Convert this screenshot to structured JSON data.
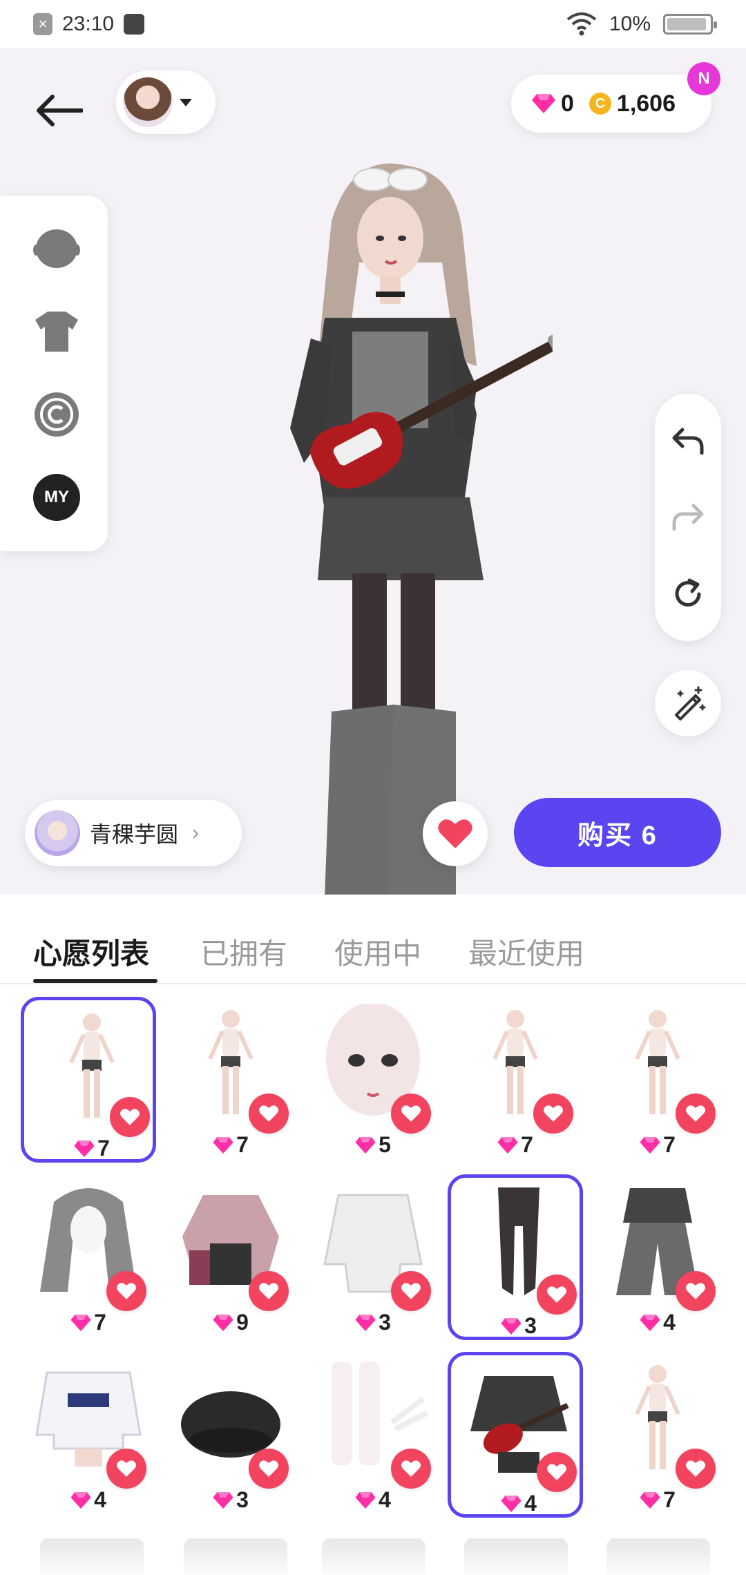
{
  "status_bar": {
    "time": "23:10",
    "battery": "10%"
  },
  "header": {
    "gems": "0",
    "coins": "1,606",
    "badge": "N"
  },
  "side_menu": {
    "my_label": "MY"
  },
  "creator": {
    "name": "青稞芋圆",
    "chevron": "›"
  },
  "buy_button": {
    "label": "购买 6"
  },
  "tabs": [
    {
      "label": "心愿列表",
      "active": true
    },
    {
      "label": "已拥有"
    },
    {
      "label": "使用中"
    },
    {
      "label": "最近使用"
    }
  ],
  "items": [
    {
      "price": "7",
      "selected": true,
      "thumb": "body"
    },
    {
      "price": "7",
      "selected": false,
      "thumb": "body"
    },
    {
      "price": "5",
      "selected": false,
      "thumb": "face"
    },
    {
      "price": "7",
      "selected": false,
      "thumb": "body"
    },
    {
      "price": "7",
      "selected": false,
      "thumb": "body"
    },
    {
      "price": "7",
      "selected": false,
      "thumb": "hair"
    },
    {
      "price": "9",
      "selected": false,
      "thumb": "outfit"
    },
    {
      "price": "3",
      "selected": false,
      "thumb": "sweater"
    },
    {
      "price": "3",
      "selected": true,
      "thumb": "tights"
    },
    {
      "price": "4",
      "selected": false,
      "thumb": "jeans"
    },
    {
      "price": "4",
      "selected": false,
      "thumb": "hoodie"
    },
    {
      "price": "3",
      "selected": false,
      "thumb": "beret"
    },
    {
      "price": "4",
      "selected": false,
      "thumb": "socks"
    },
    {
      "price": "4",
      "selected": true,
      "thumb": "guitar-outfit"
    },
    {
      "price": "7",
      "selected": false,
      "thumb": "body"
    }
  ],
  "colors": {
    "accent": "#5a45f0",
    "heart": "#f2445f",
    "gem": "#ff2ea6",
    "coin": "#f6b51c"
  }
}
